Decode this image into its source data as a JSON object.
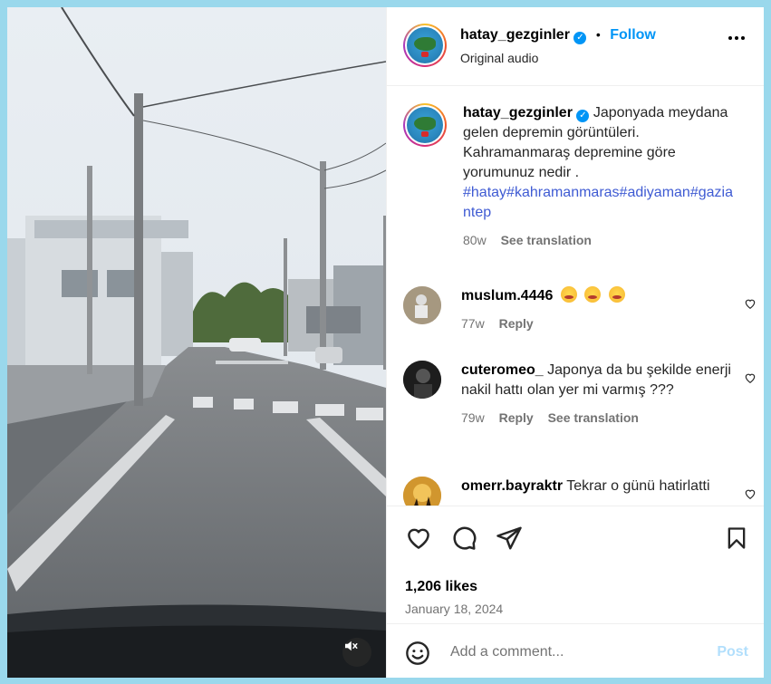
{
  "post": {
    "username": "hatay_gezginler",
    "follow_label": "Follow",
    "separator": "•",
    "audio": "Original audio",
    "caption": "Japonyada meydana gelen depremin görüntüleri. Kahramanmaraş depremine göre yorumunuz nedir .",
    "hashtags": "#hatay#kahramanmaras#adiyaman#gaziantep",
    "caption_age": "80w",
    "caption_translation": "See translation",
    "likes": "1,206 likes",
    "date": "January 18, 2024"
  },
  "comments": [
    {
      "user": "muslum.4446",
      "text": "",
      "emojis": [
        "flushed-emoji",
        "flushed-emoji",
        "flushed-emoji"
      ],
      "age": "77w",
      "reply": "Reply",
      "translation": ""
    },
    {
      "user": "cuteromeo_",
      "text": "Japonya da bu şekilde enerji nakil hattı olan yer mi varmış ???",
      "emojis": [],
      "age": "79w",
      "reply": "Reply",
      "translation": "See translation"
    },
    {
      "user": "omerr.bayraktr",
      "text": "Tekrar o günü hatirlatti",
      "emojis": [],
      "age": "",
      "reply": "",
      "translation": ""
    }
  ],
  "composer": {
    "placeholder": "Add a comment...",
    "post_label": "Post"
  },
  "icons": {
    "verified": "verified-badge-icon",
    "more": "more-horizontal-icon",
    "like": "heart-icon",
    "comment": "comment-icon",
    "share": "send-icon",
    "save": "bookmark-icon",
    "emoji": "smiley-icon",
    "mute": "speaker-muted-icon"
  },
  "colors": {
    "accent": "#0095f6",
    "hashtag": "#3f5bd3",
    "muted_text": "#737373",
    "post_disabled": "#b2dffc",
    "background": "#9ad8ec"
  }
}
